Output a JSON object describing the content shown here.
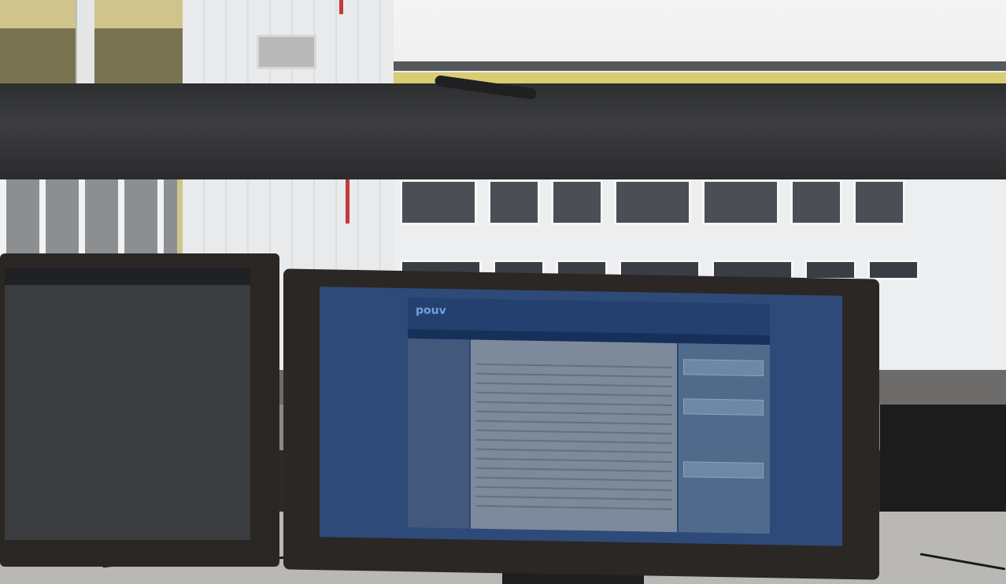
{
  "scene": {
    "description_kind": "office desk with two monitors in front of a window",
    "left_monitor": {},
    "right_monitor": {
      "brand": "",
      "site_logo": "pouv",
      "content_title": "",
      "sidebar_title": ""
    }
  },
  "colors": {
    "screen_blue": "#2e4a78",
    "window_frame": "#2d2e30",
    "building_yellow": "#cfc58c"
  }
}
